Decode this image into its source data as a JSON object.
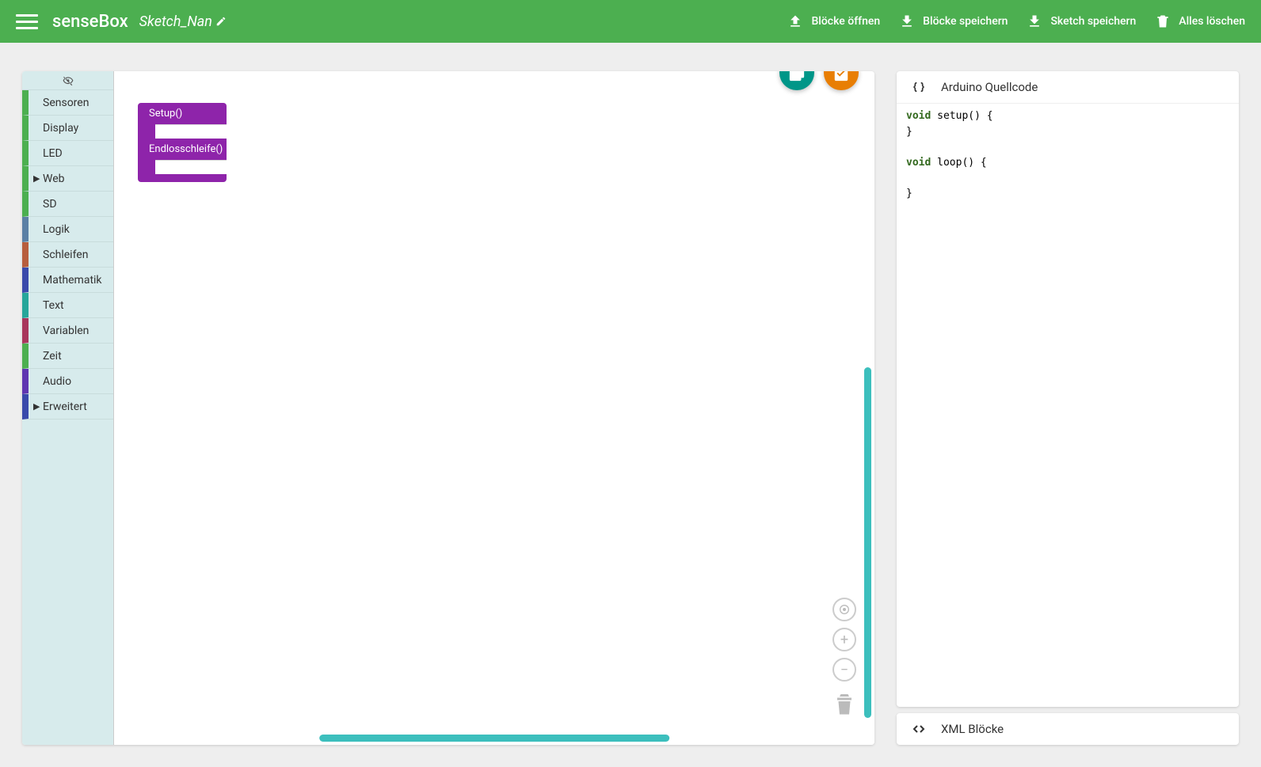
{
  "header": {
    "logo": "senseBox",
    "sketch_name": "Sketch_Nan",
    "actions": {
      "open": "Blöcke öffnen",
      "save_blocks": "Blöcke speichern",
      "save_sketch": "Sketch speichern",
      "delete_all": "Alles löschen"
    }
  },
  "toolbox": [
    {
      "label": "Sensoren",
      "color": "#4caf50",
      "expandable": false
    },
    {
      "label": "Display",
      "color": "#4caf50",
      "expandable": false
    },
    {
      "label": "LED",
      "color": "#4caf50",
      "expandable": false
    },
    {
      "label": "Web",
      "color": "#4caf50",
      "expandable": true
    },
    {
      "label": "SD",
      "color": "#4caf50",
      "expandable": false
    },
    {
      "label": "Logik",
      "color": "#5b80a5",
      "expandable": false
    },
    {
      "label": "Schleifen",
      "color": "#b75d3d",
      "expandable": false
    },
    {
      "label": "Mathematik",
      "color": "#3949ab",
      "expandable": false
    },
    {
      "label": "Text",
      "color": "#26a69a",
      "expandable": false
    },
    {
      "label": "Variablen",
      "color": "#a8365c",
      "expandable": false
    },
    {
      "label": "Zeit",
      "color": "#4caf50",
      "expandable": false
    },
    {
      "label": "Audio",
      "color": "#5e35b1",
      "expandable": false
    },
    {
      "label": "Erweitert",
      "color": "#3949ab",
      "expandable": true
    }
  ],
  "blocks": {
    "setup": "Setup()",
    "loop": "Endlosschleife()"
  },
  "code_panel": {
    "title": "Arduino Quellcode",
    "code_lines": [
      {
        "kw": "void",
        "rest": " setup() {"
      },
      {
        "kw": "",
        "rest": "}"
      },
      {
        "kw": "",
        "rest": ""
      },
      {
        "kw": "void",
        "rest": " loop() {"
      },
      {
        "kw": "",
        "rest": ""
      },
      {
        "kw": "",
        "rest": "}"
      }
    ]
  },
  "xml_panel": {
    "title": "XML Blöcke"
  },
  "colors": {
    "green": "#4caf50",
    "teal": "#009688",
    "orange": "#e87e04",
    "purple": "#8e24aa"
  }
}
